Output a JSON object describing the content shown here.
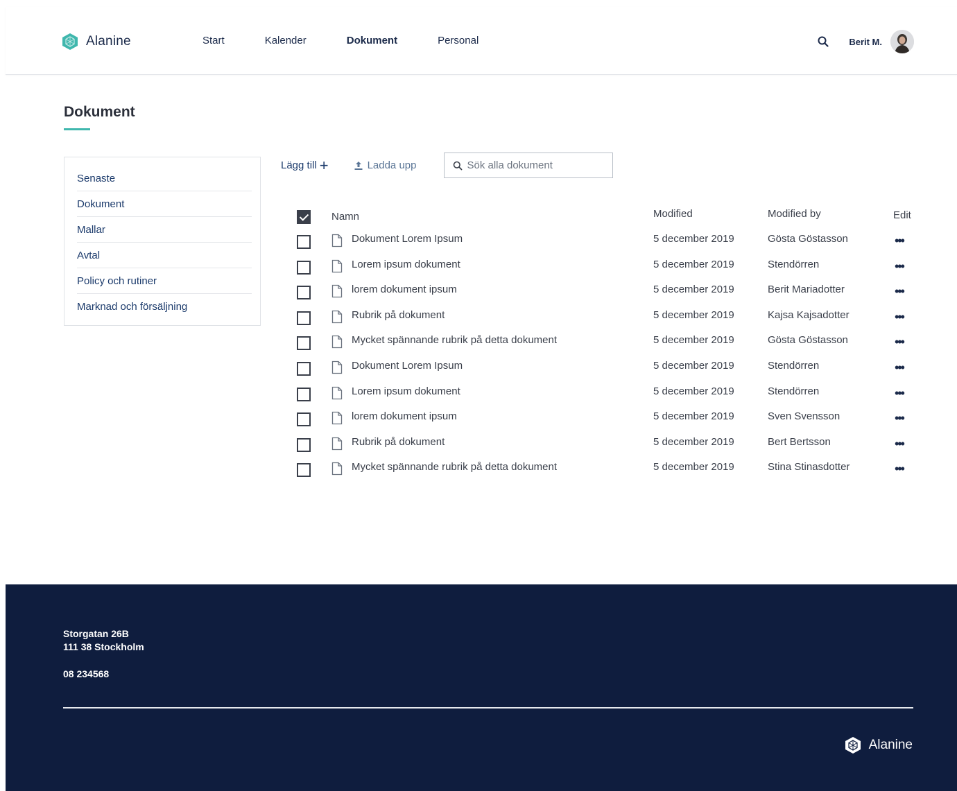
{
  "header": {
    "brand": "Alanine",
    "nav": [
      {
        "label": "Start",
        "active": false
      },
      {
        "label": "Kalender",
        "active": false
      },
      {
        "label": "Dokument",
        "active": true
      },
      {
        "label": "Personal",
        "active": false
      }
    ],
    "user_name": "Berit M."
  },
  "page": {
    "title": "Dokument"
  },
  "sidebar": {
    "items": [
      {
        "label": "Senaste"
      },
      {
        "label": "Dokument"
      },
      {
        "label": "Mallar"
      },
      {
        "label": "Avtal"
      },
      {
        "label": "Policy och rutiner"
      },
      {
        "label": "Marknad och försäljning"
      }
    ]
  },
  "toolbar": {
    "add_label": "Lägg till",
    "add_icon": "+",
    "upload_label": "Ladda upp",
    "search_placeholder": "Sök alla dokument",
    "search_value": ""
  },
  "table": {
    "select_all_checked": true,
    "columns": {
      "name": "Namn",
      "modified": "Modified",
      "modified_by": "Modified by",
      "edit": "Edit"
    },
    "edit_glyph": "•••",
    "rows": [
      {
        "name": "Dokument Lorem Ipsum",
        "modified": "5 december 2019",
        "modified_by": "Gösta Göstasson"
      },
      {
        "name": "Lorem ipsum dokument",
        "modified": "5 december 2019",
        "modified_by": "Stendörren"
      },
      {
        "name": "lorem dokument ipsum",
        "modified": "5 december 2019",
        "modified_by": "Berit Mariadotter"
      },
      {
        "name": "Rubrik på dokument",
        "modified": "5 december 2019",
        "modified_by": "Kajsa Kajsadotter"
      },
      {
        "name": "Mycket spännande rubrik på detta dokument",
        "modified": "5 december 2019",
        "modified_by": "Gösta Göstasson"
      },
      {
        "name": "Dokument Lorem Ipsum",
        "modified": "5 december 2019",
        "modified_by": "Stendörren"
      },
      {
        "name": "Lorem ipsum dokument",
        "modified": "5 december 2019",
        "modified_by": "Stendörren"
      },
      {
        "name": "lorem dokument ipsum",
        "modified": "5 december 2019",
        "modified_by": "Sven Svensson"
      },
      {
        "name": "Rubrik på dokument",
        "modified": "5 december 2019",
        "modified_by": "Bert Bertsson"
      },
      {
        "name": "Mycket spännande rubrik på detta dokument",
        "modified": "5 december 2019",
        "modified_by": "Stina Stinasdotter"
      }
    ]
  },
  "footer": {
    "address_line1": "Storgatan 26B",
    "address_line2": "111 38 Stockholm",
    "phone": "08 234568",
    "brand": "Alanine"
  },
  "colors": {
    "accent": "#3fb7ad",
    "navy": "#0f1d3e",
    "link": "#1b3a6b"
  },
  "icons": {
    "logo": "hexagon-logo-icon",
    "search": "search-icon",
    "upload": "upload-icon",
    "document": "document-icon",
    "more": "more-dots-icon"
  }
}
